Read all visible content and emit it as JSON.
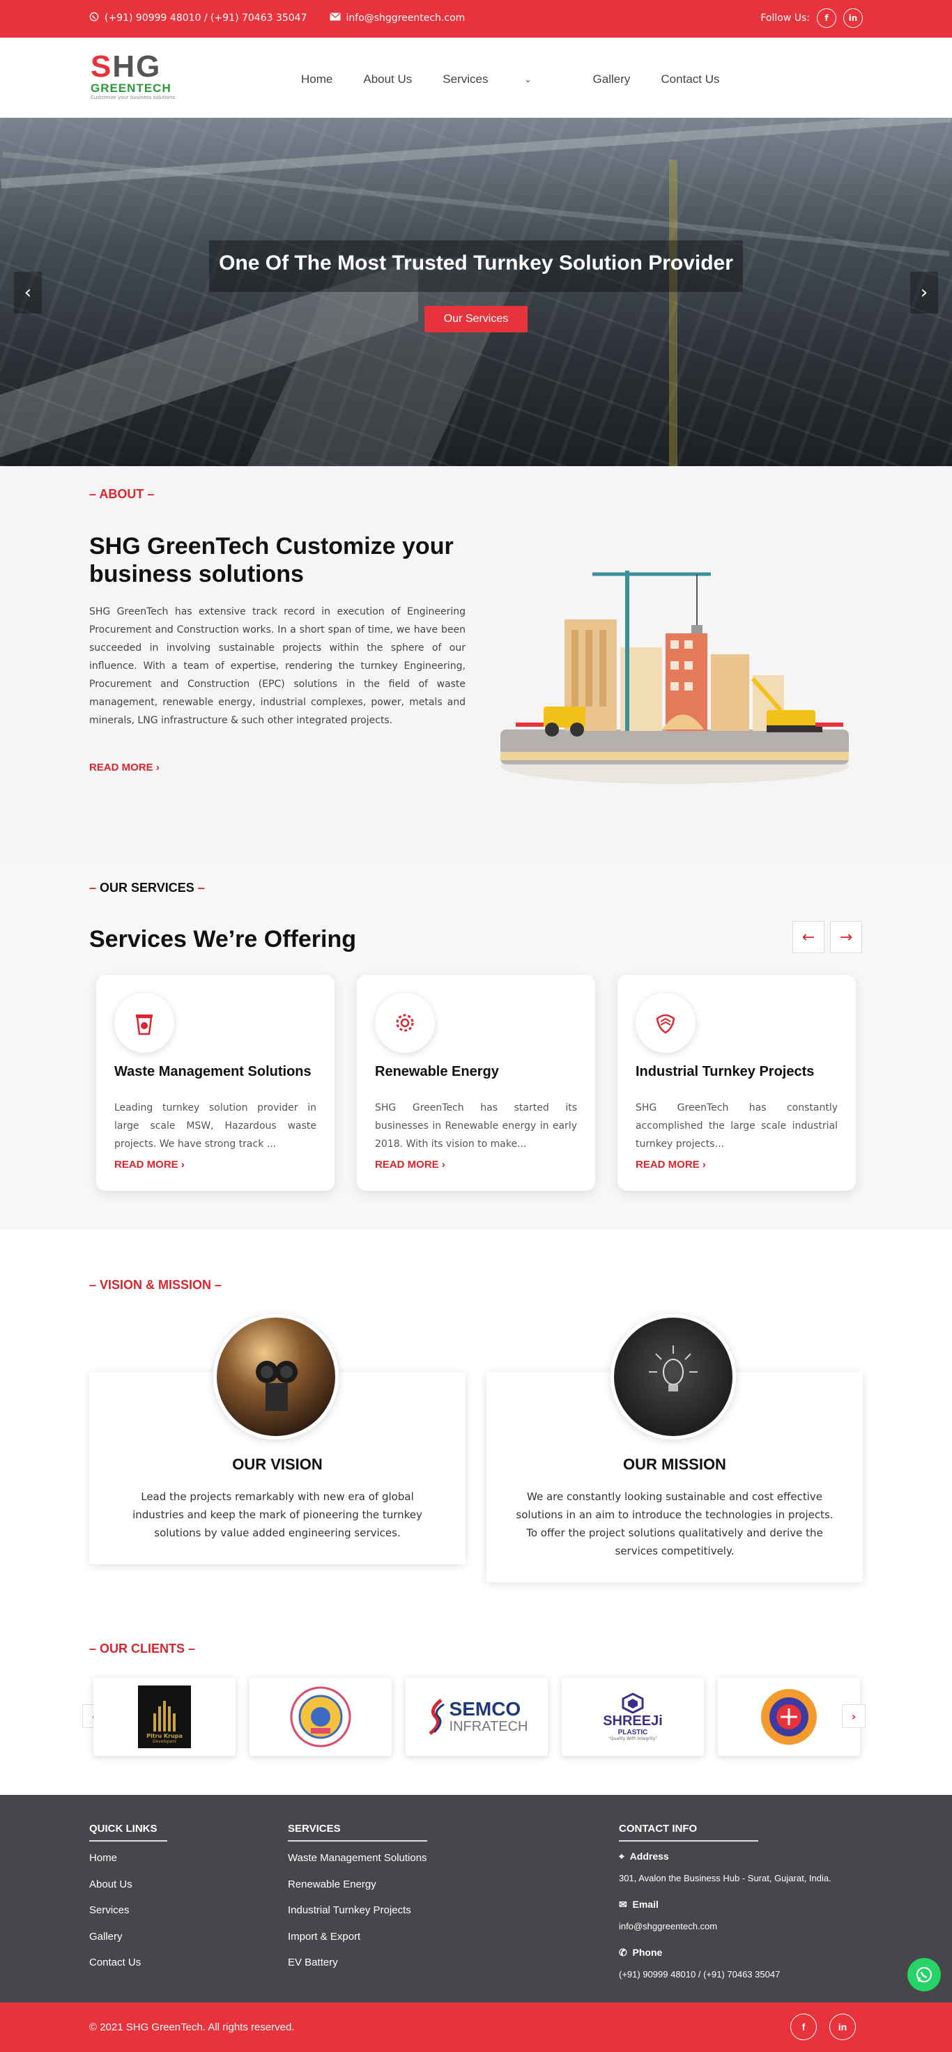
{
  "topbar": {
    "phone": "(+91) 90999 48010 / (+91) 70463 35047",
    "email": "info@shggreentech.com",
    "follow_label": "Follow Us:",
    "social": [
      "f",
      "in"
    ]
  },
  "header": {
    "logo_main": "SHG",
    "logo_sub": "GREENTECH",
    "logo_tagline": "Customize your business solutions",
    "nav": [
      "Home",
      "About Us",
      "Services",
      "Gallery",
      "Contact Us"
    ]
  },
  "hero": {
    "title": "One Of The Most Trusted Turnkey Solution Provider",
    "button": "Our Services",
    "prev": "‹",
    "next": "›"
  },
  "about": {
    "eyebrow": "ABOUT",
    "title": "SHG GreenTech Customize your business solutions",
    "text": "SHG GreenTech has extensive track record in execution of Engineering Procurement and Construction works. In a short span of time, we have been succeeded in involving sustainable projects within the sphere of our influence. With a team of expertise, rendering the turnkey Engineering, Procurement and Construction (EPC) solutions in the field of waste management, renewable energy, industrial complexes, power, metals and minerals, LNG infrastructure & such other integrated projects.",
    "read_more": "READ MORE"
  },
  "services": {
    "eyebrow": "OUR SERVICES",
    "title": "Services We’re Offering",
    "prev": "←",
    "next": "→",
    "cards": [
      {
        "title": "Waste Management Solutions",
        "text": "Leading turnkey solution provider in large scale MSW, Hazardous waste projects. We have strong track ...",
        "read_more": "READ MORE",
        "icon": "waste-bin-icon"
      },
      {
        "title": "Renewable Energy",
        "text": "SHG GreenTech has started its businesses in Renewable energy in early 2018. With its vision to make...",
        "read_more": "READ MORE",
        "icon": "gear-leaf-icon"
      },
      {
        "title": "Industrial Turnkey Projects",
        "text": "SHG GreenTech has constantly accomplished the large scale industrial turnkey projects...",
        "read_more": "READ MORE",
        "icon": "hand-shield-icon"
      }
    ]
  },
  "vision_mission": {
    "eyebrow": "VISION & MISSION",
    "vision_title": "OUR VISION",
    "vision_text": "Lead the projects remarkably with new era of global industries and keep the mark of pioneering the turnkey solutions by value added engineering services.",
    "mission_title": "OUR MISSION",
    "mission_text": "We are constantly looking sustainable and cost effective solutions in an aim to introduce the technologies in projects. To offer the project solutions qualitatively and derive the services competitively."
  },
  "clients": {
    "eyebrow": "OUR CLIENTS",
    "logos": [
      {
        "line1": "Pitru Krupa",
        "line2": "Developers"
      },
      {
        "line1": "",
        "line2": ""
      },
      {
        "line1": "SEMCO",
        "line2": "INFRATECH"
      },
      {
        "line1": "SHREEJi",
        "line2": "PLASTIC",
        "line3": "\"Quality With Integrity\""
      },
      {
        "line1": "",
        "line2": ""
      }
    ],
    "prev": "‹",
    "next": "›"
  },
  "footer": {
    "quick_links_title": "QUICK LINKS",
    "quick_links": [
      "Home",
      "About Us",
      "Services",
      "Gallery",
      "Contact Us"
    ],
    "services_title": "SERVICES",
    "services_links": [
      "Waste Management Solutions",
      "Renewable Energy",
      "Industrial Turnkey Projects",
      "Import & Export",
      "EV Battery"
    ],
    "contact_title": "CONTACT INFO",
    "address_label": "Address",
    "address": "301, Avalon the Business Hub - Surat, Gujarat, India.",
    "email_label": "Email",
    "email": "info@shggreentech.com",
    "phone_label": "Phone",
    "phone": "(+91) 90999 48010 / (+91) 70463 35047",
    "copyright": "© 2021 SHG GreenTech. All rights reserved.",
    "social": [
      "f",
      "in"
    ]
  },
  "colors": {
    "brand_red": "#e8323c",
    "footer_gray": "#47474b",
    "logo_green": "#2a9d3a"
  }
}
